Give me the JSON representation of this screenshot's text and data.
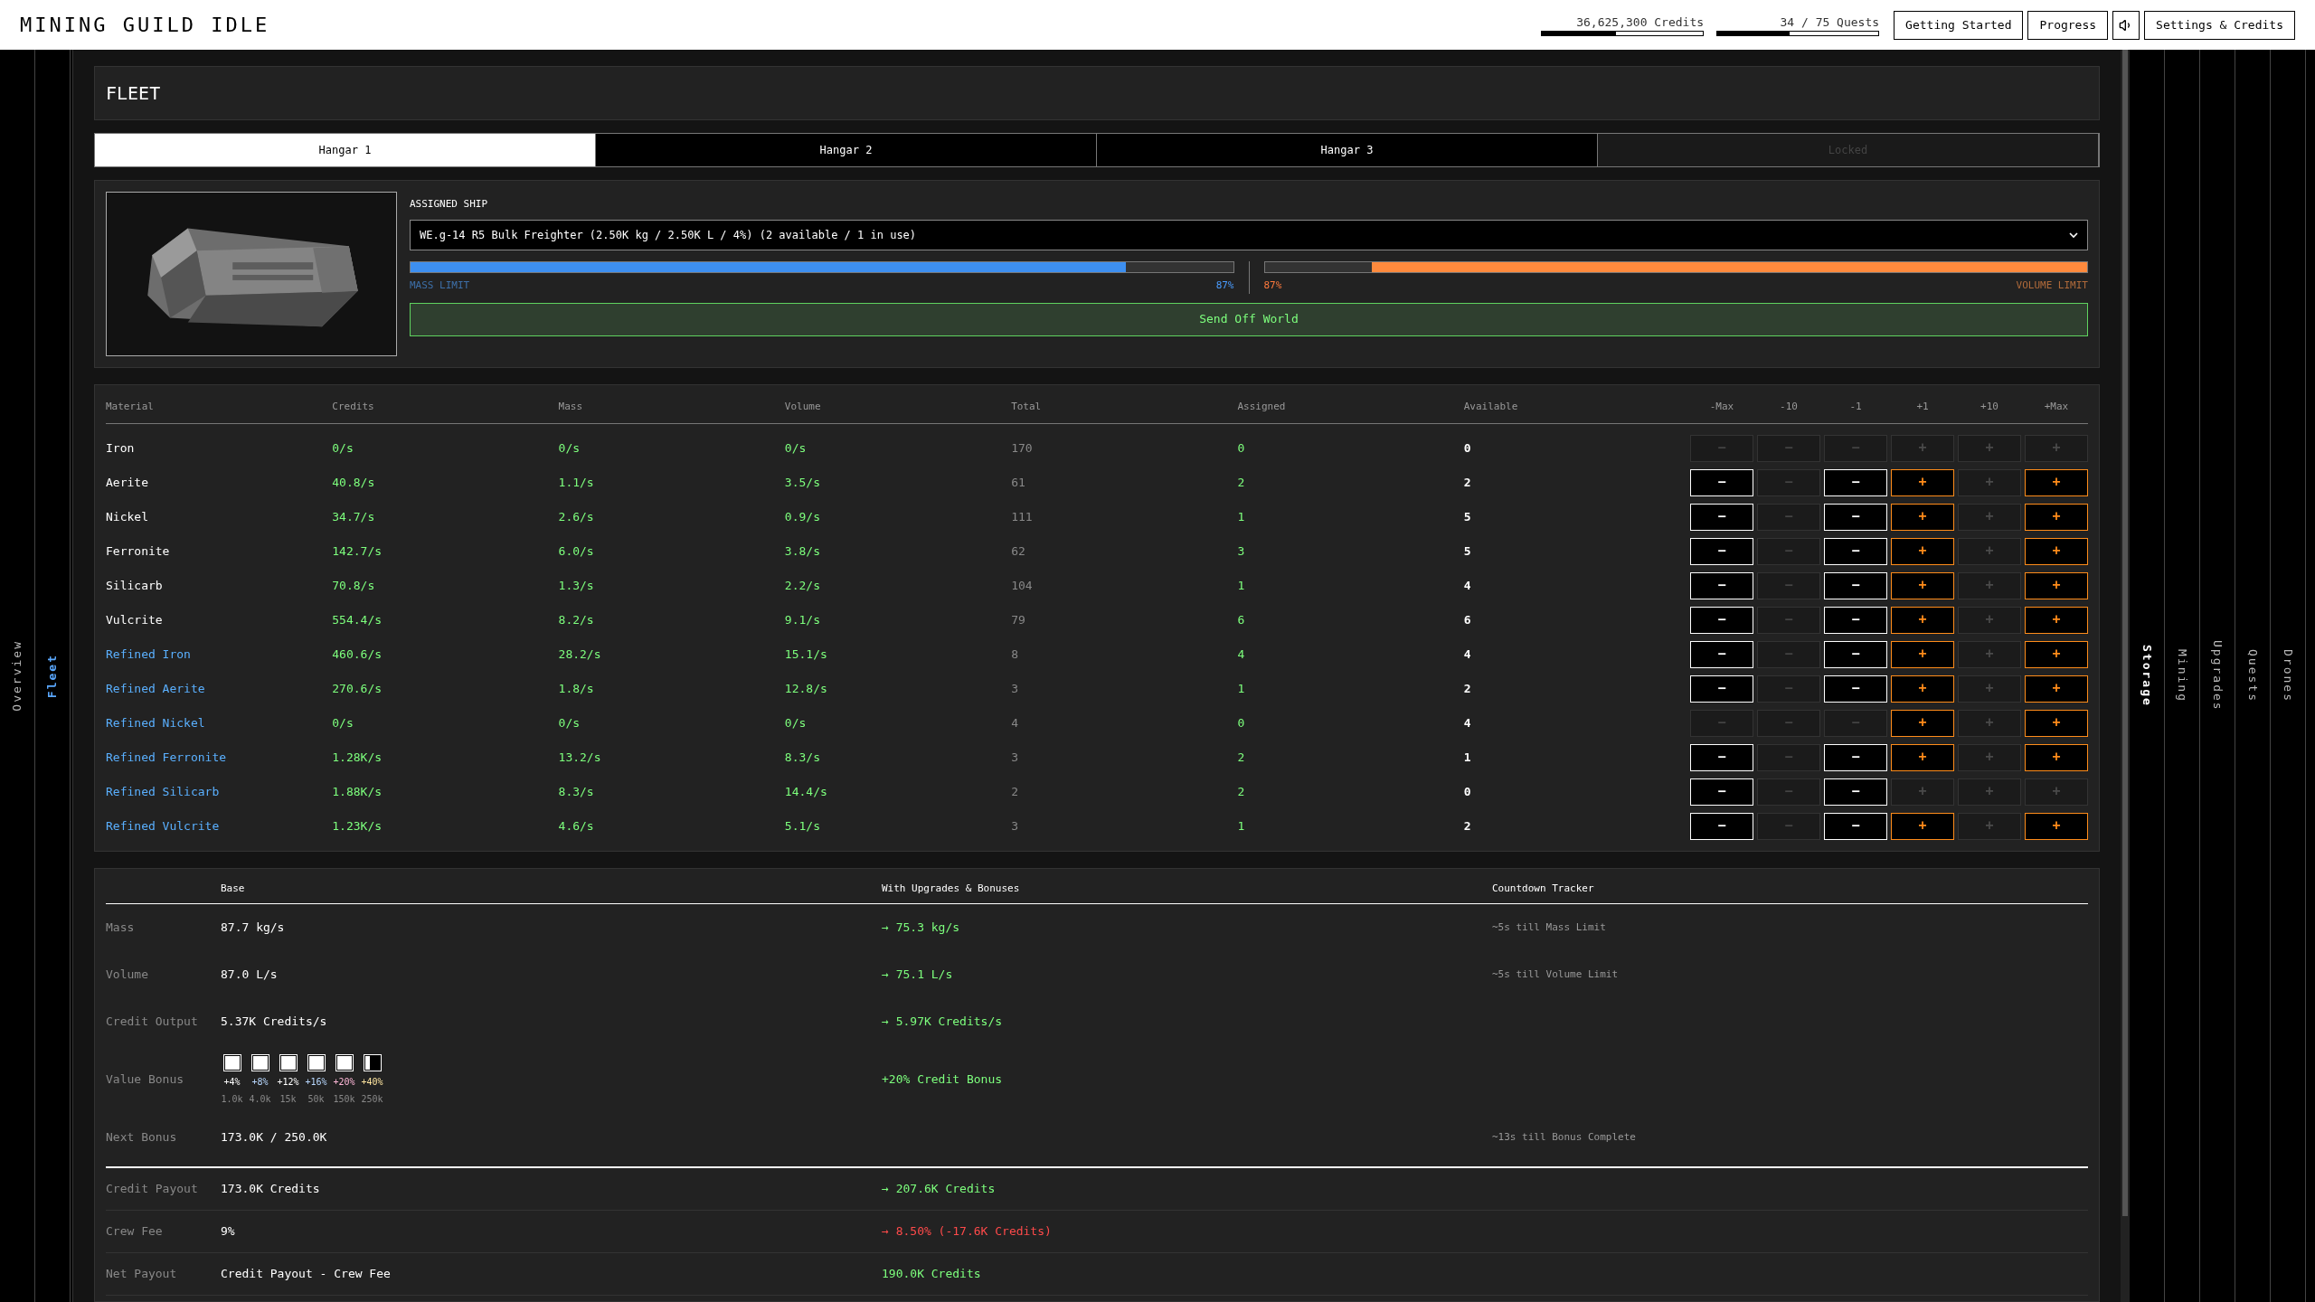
{
  "app_title": "MINING GUILD IDLE",
  "header": {
    "credits": {
      "text": "36,625,300 Credits",
      "level": 0.46
    },
    "quests": {
      "text": "34 / 75 Quests",
      "level": 0.45
    },
    "buttons": [
      "Getting Started",
      "Progress"
    ],
    "settings": "Settings & Credits"
  },
  "left_tabs": [
    {
      "label": "Overview",
      "selected": false
    },
    {
      "label": "Fleet",
      "selected": true
    }
  ],
  "right_tabs": [
    {
      "label": "Storage",
      "selected": true
    },
    {
      "label": "Mining",
      "selected": false
    },
    {
      "label": "Upgrades",
      "selected": false
    },
    {
      "label": "Quests",
      "selected": false
    },
    {
      "label": "Drones",
      "selected": false
    }
  ],
  "section_title": "FLEET",
  "hangar_tabs": [
    {
      "label": "Hangar 1",
      "selected": true,
      "disabled": false
    },
    {
      "label": "Hangar 2",
      "selected": false,
      "disabled": false
    },
    {
      "label": "Hangar 3",
      "selected": false,
      "disabled": false
    },
    {
      "label": "Locked",
      "selected": false,
      "disabled": true
    }
  ],
  "ship": {
    "assigned_label": "ASSIGNED SHIP",
    "selected_ship": "WE.g-14 R5 Bulk Freighter (2.50K kg / 2.50K L / 4%) (2 available / 1 in use)",
    "mass": {
      "label": "MASS LIMIT",
      "reading": "87%",
      "level": 0.87
    },
    "volume": {
      "label": "VOLUME LIMIT",
      "reading": "87%",
      "level": 0.87
    },
    "send_button": "Send Off World"
  },
  "materials": {
    "columns": [
      "Material",
      "Credits",
      "Mass",
      "Volume",
      "Total",
      "Assigned",
      "Available"
    ],
    "button_columns": [
      "-Max",
      "-10",
      "-1",
      "+1",
      "+10",
      "+Max"
    ],
    "rows": [
      {
        "name": "Iron",
        "kind": "raw",
        "credits": "0/s",
        "mass": "0/s",
        "volume": "0/s",
        "total": "170",
        "assigned": "0",
        "available": "0",
        "buttons": [
          {
            "kind": "minus",
            "label": "−",
            "enabled": false
          },
          {
            "kind": "minus",
            "label": "−",
            "enabled": false
          },
          {
            "kind": "minus",
            "label": "−",
            "enabled": false
          },
          {
            "kind": "plus",
            "label": "+",
            "enabled": false
          },
          {
            "kind": "plus",
            "label": "+",
            "enabled": false
          },
          {
            "kind": "plus",
            "label": "+",
            "enabled": false
          }
        ]
      },
      {
        "name": "Aerite",
        "kind": "raw",
        "credits": "40.8/s",
        "mass": "1.1/s",
        "volume": "3.5/s",
        "total": "61",
        "assigned": "2",
        "available": "2",
        "buttons": [
          {
            "kind": "minus",
            "label": "−",
            "enabled": true
          },
          {
            "kind": "minus",
            "label": "−",
            "enabled": false
          },
          {
            "kind": "minus",
            "label": "−",
            "enabled": true
          },
          {
            "kind": "plus",
            "label": "+",
            "enabled": true
          },
          {
            "kind": "plus",
            "label": "+",
            "enabled": false
          },
          {
            "kind": "plus",
            "label": "+",
            "enabled": true
          }
        ]
      },
      {
        "name": "Nickel",
        "kind": "raw",
        "credits": "34.7/s",
        "mass": "2.6/s",
        "volume": "0.9/s",
        "total": "111",
        "assigned": "1",
        "available": "5",
        "buttons": [
          {
            "kind": "minus",
            "label": "−",
            "enabled": true
          },
          {
            "kind": "minus",
            "label": "−",
            "enabled": false
          },
          {
            "kind": "minus",
            "label": "−",
            "enabled": true
          },
          {
            "kind": "plus",
            "label": "+",
            "enabled": true
          },
          {
            "kind": "plus",
            "label": "+",
            "enabled": false
          },
          {
            "kind": "plus",
            "label": "+",
            "enabled": true
          }
        ]
      },
      {
        "name": "Ferronite",
        "kind": "raw",
        "credits": "142.7/s",
        "mass": "6.0/s",
        "volume": "3.8/s",
        "total": "62",
        "assigned": "3",
        "available": "5",
        "buttons": [
          {
            "kind": "minus",
            "label": "−",
            "enabled": true
          },
          {
            "kind": "minus",
            "label": "−",
            "enabled": false
          },
          {
            "kind": "minus",
            "label": "−",
            "enabled": true
          },
          {
            "kind": "plus",
            "label": "+",
            "enabled": true
          },
          {
            "kind": "plus",
            "label": "+",
            "enabled": false
          },
          {
            "kind": "plus",
            "label": "+",
            "enabled": true
          }
        ]
      },
      {
        "name": "Silicarb",
        "kind": "raw",
        "credits": "70.8/s",
        "mass": "1.3/s",
        "volume": "2.2/s",
        "total": "104",
        "assigned": "1",
        "available": "4",
        "buttons": [
          {
            "kind": "minus",
            "label": "−",
            "enabled": true
          },
          {
            "kind": "minus",
            "label": "−",
            "enabled": false
          },
          {
            "kind": "minus",
            "label": "−",
            "enabled": true
          },
          {
            "kind": "plus",
            "label": "+",
            "enabled": true
          },
          {
            "kind": "plus",
            "label": "+",
            "enabled": false
          },
          {
            "kind": "plus",
            "label": "+",
            "enabled": true
          }
        ]
      },
      {
        "name": "Vulcrite",
        "kind": "raw",
        "credits": "554.4/s",
        "mass": "8.2/s",
        "volume": "9.1/s",
        "total": "79",
        "assigned": "6",
        "available": "6",
        "buttons": [
          {
            "kind": "minus",
            "label": "−",
            "enabled": true
          },
          {
            "kind": "minus",
            "label": "−",
            "enabled": false
          },
          {
            "kind": "minus",
            "label": "−",
            "enabled": true
          },
          {
            "kind": "plus",
            "label": "+",
            "enabled": true
          },
          {
            "kind": "plus",
            "label": "+",
            "enabled": false
          },
          {
            "kind": "plus",
            "label": "+",
            "enabled": true
          }
        ]
      },
      {
        "name": "Refined Iron",
        "kind": "refined",
        "credits": "460.6/s",
        "mass": "28.2/s",
        "volume": "15.1/s",
        "total": "8",
        "assigned": "4",
        "available": "4",
        "buttons": [
          {
            "kind": "minus",
            "label": "−",
            "enabled": true
          },
          {
            "kind": "minus",
            "label": "−",
            "enabled": false
          },
          {
            "kind": "minus",
            "label": "−",
            "enabled": true
          },
          {
            "kind": "plus",
            "label": "+",
            "enabled": true
          },
          {
            "kind": "plus",
            "label": "+",
            "enabled": false
          },
          {
            "kind": "plus",
            "label": "+",
            "enabled": true
          }
        ]
      },
      {
        "name": "Refined Aerite",
        "kind": "refined",
        "credits": "270.6/s",
        "mass": "1.8/s",
        "volume": "12.8/s",
        "total": "3",
        "assigned": "1",
        "available": "2",
        "buttons": [
          {
            "kind": "minus",
            "label": "−",
            "enabled": true
          },
          {
            "kind": "minus",
            "label": "−",
            "enabled": false
          },
          {
            "kind": "minus",
            "label": "−",
            "enabled": true
          },
          {
            "kind": "plus",
            "label": "+",
            "enabled": true
          },
          {
            "kind": "plus",
            "label": "+",
            "enabled": false
          },
          {
            "kind": "plus",
            "label": "+",
            "enabled": true
          }
        ]
      },
      {
        "name": "Refined Nickel",
        "kind": "refined",
        "credits": "0/s",
        "mass": "0/s",
        "volume": "0/s",
        "total": "4",
        "assigned": "0",
        "available": "4",
        "buttons": [
          {
            "kind": "minus",
            "label": "−",
            "enabled": false
          },
          {
            "kind": "minus",
            "label": "−",
            "enabled": false
          },
          {
            "kind": "minus",
            "label": "−",
            "enabled": false
          },
          {
            "kind": "plus",
            "label": "+",
            "enabled": true
          },
          {
            "kind": "plus",
            "label": "+",
            "enabled": false
          },
          {
            "kind": "plus",
            "label": "+",
            "enabled": true
          }
        ]
      },
      {
        "name": "Refined Ferronite",
        "kind": "refined",
        "credits": "1.28K/s",
        "mass": "13.2/s",
        "volume": "8.3/s",
        "total": "3",
        "assigned": "2",
        "available": "1",
        "buttons": [
          {
            "kind": "minus",
            "label": "−",
            "enabled": true
          },
          {
            "kind": "minus",
            "label": "−",
            "enabled": false
          },
          {
            "kind": "minus",
            "label": "−",
            "enabled": true
          },
          {
            "kind": "plus",
            "label": "+",
            "enabled": true
          },
          {
            "kind": "plus",
            "label": "+",
            "enabled": false
          },
          {
            "kind": "plus",
            "label": "+",
            "enabled": true
          }
        ]
      },
      {
        "name": "Refined Silicarb",
        "kind": "refined",
        "credits": "1.88K/s",
        "mass": "8.3/s",
        "volume": "14.4/s",
        "total": "2",
        "assigned": "2",
        "available": "0",
        "buttons": [
          {
            "kind": "minus",
            "label": "−",
            "enabled": true
          },
          {
            "kind": "minus",
            "label": "−",
            "enabled": false
          },
          {
            "kind": "minus",
            "label": "−",
            "enabled": true
          },
          {
            "kind": "plus",
            "label": "+",
            "enabled": false
          },
          {
            "kind": "plus",
            "label": "+",
            "enabled": false
          },
          {
            "kind": "plus",
            "label": "+",
            "enabled": false
          }
        ]
      },
      {
        "name": "Refined Vulcrite",
        "kind": "refined",
        "credits": "1.23K/s",
        "mass": "4.6/s",
        "volume": "5.1/s",
        "total": "3",
        "assigned": "1",
        "available": "2",
        "buttons": [
          {
            "kind": "minus",
            "label": "−",
            "enabled": true
          },
          {
            "kind": "minus",
            "label": "−",
            "enabled": false
          },
          {
            "kind": "minus",
            "label": "−",
            "enabled": true
          },
          {
            "kind": "plus",
            "label": "+",
            "enabled": true
          },
          {
            "kind": "plus",
            "label": "+",
            "enabled": false
          },
          {
            "kind": "plus",
            "label": "+",
            "enabled": true
          }
        ]
      }
    ]
  },
  "stats": {
    "columns": [
      "Base",
      "With Upgrades & Bonuses",
      "Countdown Tracker"
    ],
    "rows": [
      {
        "kind": "plain",
        "label": "Mass",
        "base": "87.7 kg/s",
        "upgraded": "→ 75.3 kg/s",
        "countdown": "~5s till Mass Limit"
      },
      {
        "kind": "plain",
        "label": "Volume",
        "base": "87.0 L/s",
        "upgraded": "→ 75.1 L/s",
        "countdown": "~5s till Volume Limit"
      },
      {
        "kind": "plain",
        "label": "Credit Output",
        "base": "5.37K Credits/s",
        "upgraded": "→ 5.97K Credits/s"
      },
      {
        "kind": "bonus",
        "label": "Value Bonus",
        "tiers": [
          {
            "bonus": "+4%",
            "threshold": "1.0k",
            "level": 1,
            "color": "#ffffff"
          },
          {
            "bonus": "+8%",
            "threshold": "4.0k",
            "level": 1,
            "color": "#b8d8ff"
          },
          {
            "bonus": "+12%",
            "threshold": "15k",
            "level": 1,
            "color": "#ffffff"
          },
          {
            "bonus": "+16%",
            "threshold": "50k",
            "level": 1,
            "color": "#b8d8ff"
          },
          {
            "bonus": "+20%",
            "threshold": "150k",
            "level": 1,
            "color": "#ffb8d8"
          },
          {
            "bonus": "+40%",
            "threshold": "250k",
            "level": 0.35,
            "color": "#ffe6a0"
          }
        ],
        "upgraded": "+20% Credit Bonus"
      },
      {
        "kind": "plain",
        "label": "Next Bonus",
        "base": "173.0K / 250.0K",
        "countdown": "~13s till Bonus Complete"
      },
      {
        "kind": "divider"
      },
      {
        "kind": "plain",
        "label": "Credit Payout",
        "base": "173.0K Credits",
        "upgraded": "→ 207.6K Credits"
      },
      {
        "kind": "fee",
        "label": "Crew Fee",
        "base": "9%",
        "upgraded": "→ 8.50% (-17.6K Credits)"
      },
      {
        "kind": "plain",
        "label": "Net Payout",
        "base": "Credit Payout - Crew Fee",
        "upgraded": "190.0K Credits"
      }
    ]
  }
}
